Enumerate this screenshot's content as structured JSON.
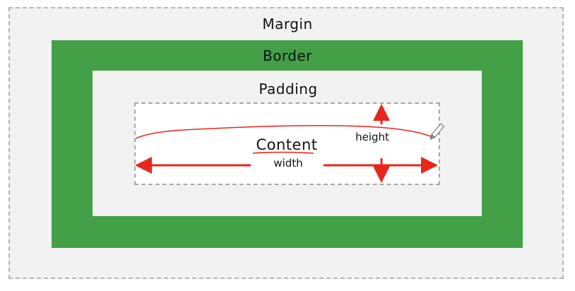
{
  "layers": {
    "margin": "Margin",
    "border": "Border",
    "padding": "Padding",
    "content": "Content"
  },
  "dimensions": {
    "width": "width",
    "height": "height"
  },
  "colors": {
    "margin_fill": "#f2f2f2",
    "border_fill": "#43a047",
    "padding_fill": "#f2f2f2",
    "content_fill": "#ffffff",
    "annotation": "#e8251b",
    "dashed_outline": "#b5b5b5"
  },
  "icons": {
    "pencil": "pencil-icon"
  }
}
